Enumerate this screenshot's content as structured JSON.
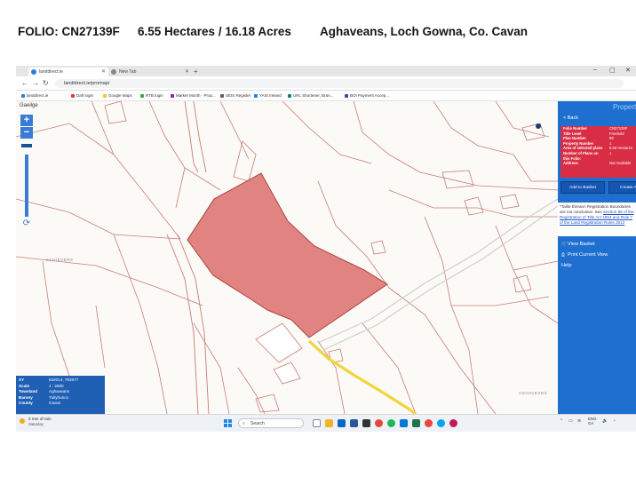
{
  "heading": {
    "folio": "FOLIO: CN27139F",
    "area": "6.55 Hectares / 16.18 Acres",
    "location": "Aghaveans, Loch Gowna, Co. Cavan"
  },
  "browser": {
    "tabs": [
      {
        "label": "landdirect.ie",
        "active": true
      },
      {
        "label": "New Tab",
        "active": false
      }
    ],
    "new_tab_glyph": "+",
    "url": "landdirect.ie/promap/",
    "bookmarks": [
      {
        "label": "landdirect.ie",
        "color": "#2a7de1"
      },
      {
        "label": "Daft login",
        "color": "#e53935"
      },
      {
        "label": "Google Maps",
        "color": "#fbc02d"
      },
      {
        "label": "RTB login",
        "color": "#43a047"
      },
      {
        "label": "Market Month · Prop...",
        "color": "#8e24aa"
      },
      {
        "label": "SEIS Register",
        "color": "#5e5e5e"
      },
      {
        "label": "YAIS Ireland",
        "color": "#1e88e5"
      },
      {
        "label": "URL Shortener, Bran...",
        "color": "#00897b"
      },
      {
        "label": "BOI Payment Accep...",
        "color": "#3949ab"
      }
    ]
  },
  "map": {
    "language_toggle": "Gaeilge",
    "zoom_in": "+",
    "zoom_out": "−",
    "labels": {
      "west": "SCHIEVERS",
      "east": "AGHAVEANS"
    },
    "parcel_color": "#e07d7b",
    "boundary_color": "#c97d74",
    "road_color": "#f2d43b",
    "info": {
      "rows": [
        {
          "key": "XY",
          "value": "632014, 792877"
        },
        {
          "key": "Scale",
          "value": "1 : 2500"
        },
        {
          "key": "Townland",
          "value": "Aghaveans"
        },
        {
          "key": "Barony",
          "value": "Tullyhunco"
        },
        {
          "key": "County",
          "value": "Cavan"
        }
      ]
    }
  },
  "panel": {
    "title": "Property",
    "back": "Back",
    "properties": [
      {
        "key": "Folio Number",
        "value": "CN27139F"
      },
      {
        "key": "Title Level",
        "value": "Freehold"
      },
      {
        "key": "Plan Number",
        "value": "98"
      },
      {
        "key": "Property Number",
        "value": "1"
      },
      {
        "key": "Area of selected plans",
        "value": "6.55 Hectares"
      },
      {
        "key": "Number of Plans on",
        "value": "1"
      },
      {
        "key": "this Folio:",
        "value": ""
      },
      {
        "key": "Address",
        "value": "Not Available"
      }
    ],
    "add_to_basket": "Add to Basket",
    "create": "Create A",
    "note_text": "*Tailte Éireann Registration Boundaries are not conclusive. See ",
    "note_link": "Section 85 of the Registration of Title Act 1964 and Rule 7 of the Land Registration Rules 2012",
    "view_basket": "View Basket",
    "print_view": "Print Current View",
    "help": "Help",
    "accent": "#1f6fd1",
    "table_color": "#d92d45"
  },
  "taskbar": {
    "weather": "2 mm of rain",
    "weather_sub": "Saturday",
    "search_placeholder": "Search",
    "lang": "ENG",
    "lang_sub": "GA"
  }
}
